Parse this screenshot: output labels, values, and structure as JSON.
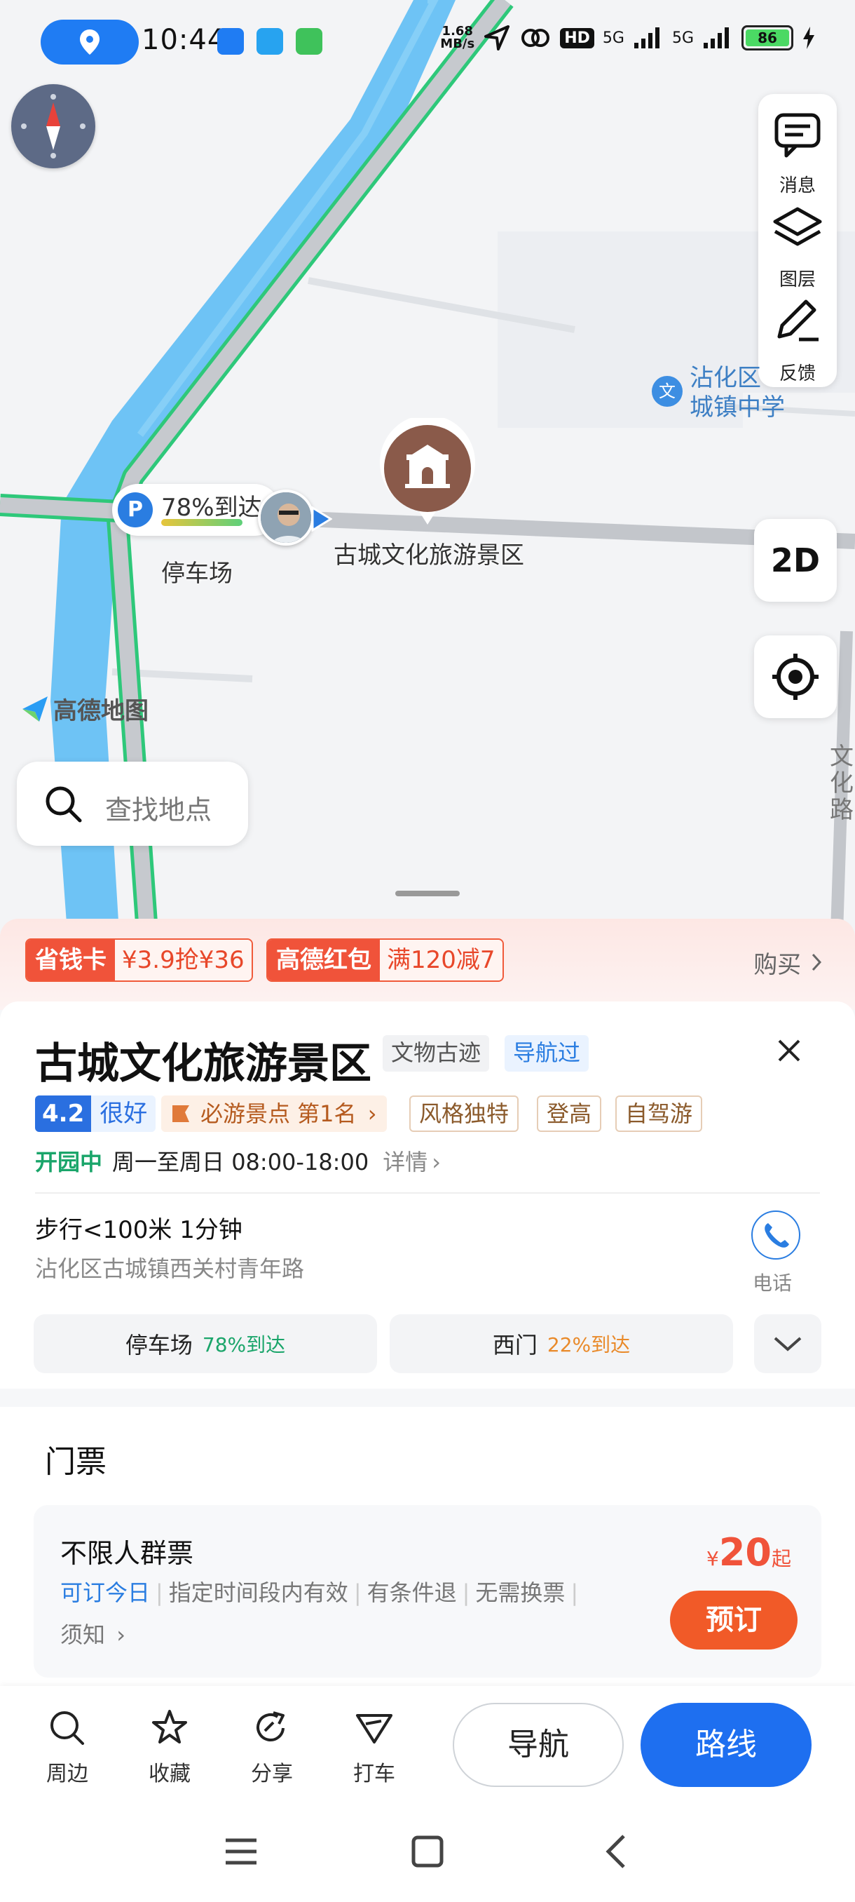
{
  "status_bar": {
    "time": "10:44",
    "net_speed_value": "1.68",
    "net_speed_unit": "MB/s",
    "hd": "HD",
    "signal1": "5G",
    "signal2": "5G",
    "battery": "86"
  },
  "map": {
    "tools": [
      {
        "label": "消息",
        "icon": "message-icon"
      },
      {
        "label": "图层",
        "icon": "layers-icon"
      },
      {
        "label": "反馈",
        "icon": "edit-icon"
      }
    ],
    "view_mode": "2D",
    "search_placeholder": "查找地点",
    "brand": "高德地图",
    "school_label_line1": "沾化区",
    "school_label_line2": "城镇中学",
    "school_badge": "文",
    "road_name": "文化路",
    "parking_badge": "P",
    "parking_arrival": "78%到达",
    "parking_label": "停车场",
    "poi_label": "古城文化旅游景区",
    "colors": {
      "river": "#6ec3f5",
      "road_outline": "#2ec87a",
      "pin": "#8a5a4a"
    }
  },
  "promo": {
    "tag1_left": "省钱卡",
    "tag1_right": "¥3.9抢¥36",
    "tag2_left": "高德红包",
    "tag2_right": "满120减7",
    "buy": "购买"
  },
  "place": {
    "name": "古城文化旅游景区",
    "category_tag": "文物古迹",
    "visited_tag": "导航过",
    "score": "4.2",
    "score_word": "很好",
    "must_see": "必游景点 第1名",
    "tags": [
      "风格独特",
      "登高",
      "自驾游"
    ],
    "open_status": "开园中",
    "hours": "周一至周日 08:00-18:00",
    "hours_more": "详情",
    "walk_info": "步行<100米 1分钟",
    "address": "沾化区古城镇西关村青年路",
    "phone_label": "电话",
    "entrances": [
      {
        "name": "停车场",
        "pct": "78%到达"
      },
      {
        "name": "西门",
        "pct": "22%到达"
      }
    ]
  },
  "tickets": {
    "heading": "门票",
    "name": "不限人群票",
    "bookable": "可订今日",
    "conditions": [
      "指定时间段内有效",
      "有条件退",
      "无需换票"
    ],
    "note": "须知",
    "currency": "¥",
    "price": "20",
    "price_suffix": "起",
    "book_label": "预订"
  },
  "bottom_bar": {
    "actions": [
      "周边",
      "收藏",
      "分享",
      "打车"
    ],
    "navigate": "导航",
    "route": "路线"
  }
}
